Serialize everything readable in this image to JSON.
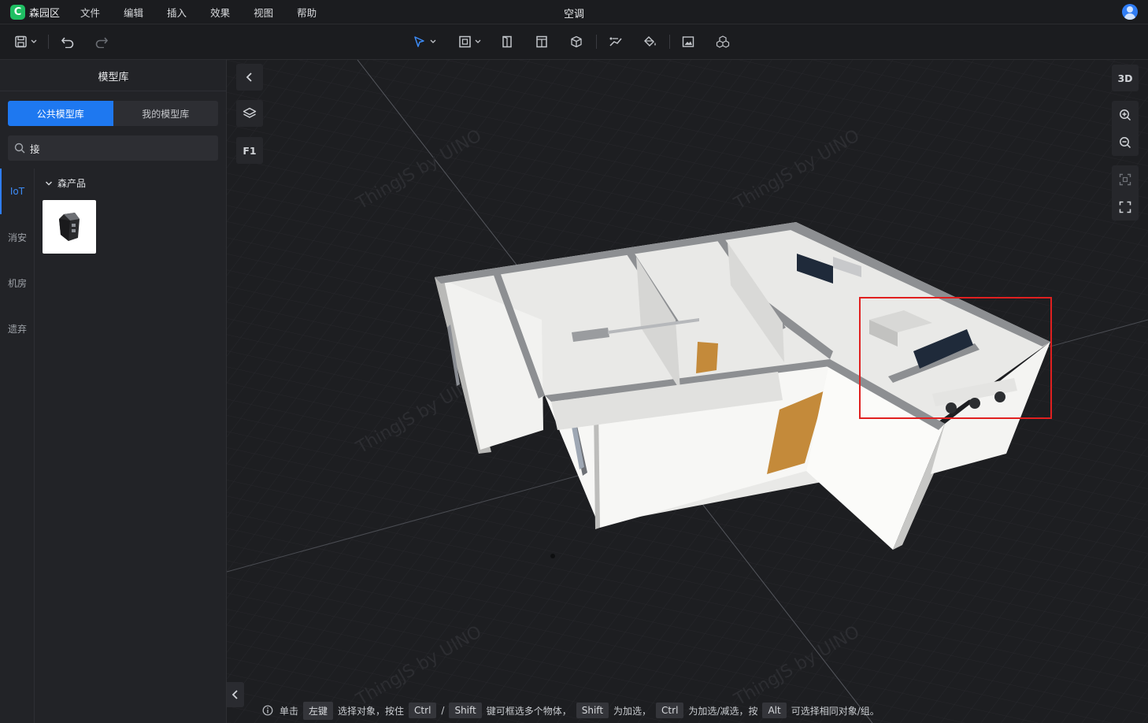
{
  "app": {
    "name": "森园区",
    "doc_title": "空调"
  },
  "menu": [
    "文件",
    "编辑",
    "插入",
    "效果",
    "视图",
    "帮助"
  ],
  "left_panel": {
    "title": "模型库",
    "tabs": [
      {
        "label": "公共模型库",
        "active": true
      },
      {
        "label": "我的模型库",
        "active": false
      }
    ],
    "search": {
      "value": "接",
      "placeholder": ""
    },
    "categories": [
      {
        "label": "IoT",
        "active": true
      },
      {
        "label": "消安",
        "active": false
      },
      {
        "label": "机房",
        "active": false
      },
      {
        "label": "遗弃",
        "active": false
      }
    ],
    "group": {
      "label": "森产品",
      "expanded": true
    }
  },
  "viewport": {
    "floor_label": "F1",
    "view_mode": "3D",
    "watermark": "ThingJS by UINO"
  },
  "status": {
    "t1": "单击",
    "k1": "左键",
    "t2": "选择对象，按住",
    "k2": "Ctrl",
    "t3": "/",
    "k3": "Shift",
    "t4": "键可框选多个物体，",
    "k4": "Shift",
    "t5": "为加选，",
    "k5": "Ctrl",
    "t6": "为加选/减选，按",
    "k6": "Alt",
    "t7": "可选择相同对象/组。"
  },
  "colors": {
    "accent": "#1e78f0",
    "selection_box": "#e02020",
    "brand": "#1fbf63"
  }
}
